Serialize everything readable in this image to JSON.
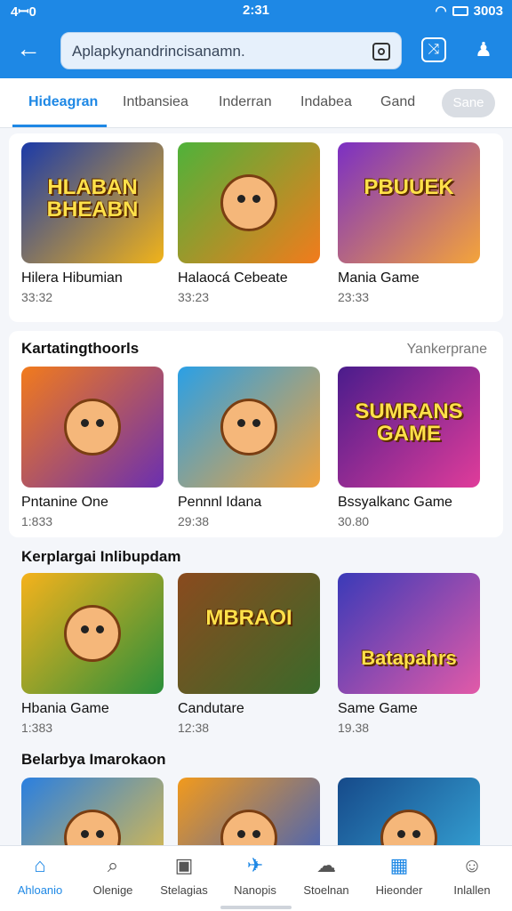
{
  "status_bar": {
    "left": "4ꟷ0",
    "time": "2:31",
    "right": "3003"
  },
  "search": {
    "placeholder": "Aplapkynandrincisanamn."
  },
  "tabs": [
    {
      "label": "Hideagran"
    },
    {
      "label": "Intbansiea"
    },
    {
      "label": "Inderran"
    },
    {
      "label": "Indabea"
    },
    {
      "label": "Gand"
    },
    {
      "label": "Sane"
    }
  ],
  "sections": [
    {
      "title": "",
      "link": "",
      "cards": [
        {
          "title": "Hilera Hibumian",
          "sub": "33:32",
          "thumb_text": "HLABAN BHEABN",
          "colors": [
            "#1b3aa8",
            "#f0b31a"
          ]
        },
        {
          "title": "Halaocá Cebeate",
          "sub": "33:23",
          "thumb_text": "",
          "colors": [
            "#4fb23a",
            "#f27b1c"
          ]
        },
        {
          "title": "Mania Game",
          "sub": "23:33",
          "thumb_text": "PBUUEK",
          "colors": [
            "#7b2fc4",
            "#f4a43a"
          ]
        }
      ]
    },
    {
      "title": "Kartatingthoorls",
      "link": "Yankerprane",
      "cards": [
        {
          "title": "Pntanine One",
          "sub": "1:833",
          "thumb_text": "",
          "colors": [
            "#f27b1c",
            "#6b2fb0"
          ]
        },
        {
          "title": "Pennnl Idana",
          "sub": "29:38",
          "thumb_text": "",
          "colors": [
            "#2aa0e6",
            "#f2a23a"
          ]
        },
        {
          "title": "Bssyalkanc Game",
          "sub": "30.80",
          "thumb_text": "SUMRANS GAME",
          "colors": [
            "#4a1c8c",
            "#e03c9a"
          ]
        }
      ]
    },
    {
      "title": "Kerplargai Inlibupdam",
      "link": "",
      "cards": [
        {
          "title": "Hbania Game",
          "sub": "1:383",
          "thumb_text": "",
          "colors": [
            "#f5b21c",
            "#2a8f3a"
          ]
        },
        {
          "title": "Candutare",
          "sub": "12:38",
          "thumb_text": "MBRAOI",
          "colors": [
            "#8a4a1e",
            "#3a6a2a"
          ]
        },
        {
          "title": "Same Game",
          "sub": "19.38",
          "thumb_text": "Batapahrs",
          "colors": [
            "#3a3ab8",
            "#e25aa8"
          ]
        }
      ]
    },
    {
      "title": "Belarbya Imarokaon",
      "link": "",
      "cards": [
        {
          "title": "",
          "sub": "",
          "thumb_text": "",
          "colors": [
            "#2a7fe0",
            "#f2c23a"
          ]
        },
        {
          "title": "",
          "sub": "",
          "thumb_text": "",
          "colors": [
            "#f29a1c",
            "#2a5ad0"
          ]
        },
        {
          "title": "",
          "sub": "",
          "thumb_text": "",
          "colors": [
            "#164a8a",
            "#3ab0e0"
          ]
        }
      ]
    }
  ],
  "bottom_nav": [
    {
      "label": "Ahloanio",
      "icon": "home-icon"
    },
    {
      "label": "Olenige",
      "icon": "search-icon"
    },
    {
      "label": "Stelagias",
      "icon": "grid-icon"
    },
    {
      "label": "Nanopis",
      "icon": "compass-icon"
    },
    {
      "label": "Stoelnan",
      "icon": "chat-icon"
    },
    {
      "label": "Hieonder",
      "icon": "calendar-icon"
    },
    {
      "label": "Inlallen",
      "icon": "person-icon"
    }
  ],
  "colors": {
    "primary": "#1e88e5",
    "background": "#f4f6fa"
  }
}
